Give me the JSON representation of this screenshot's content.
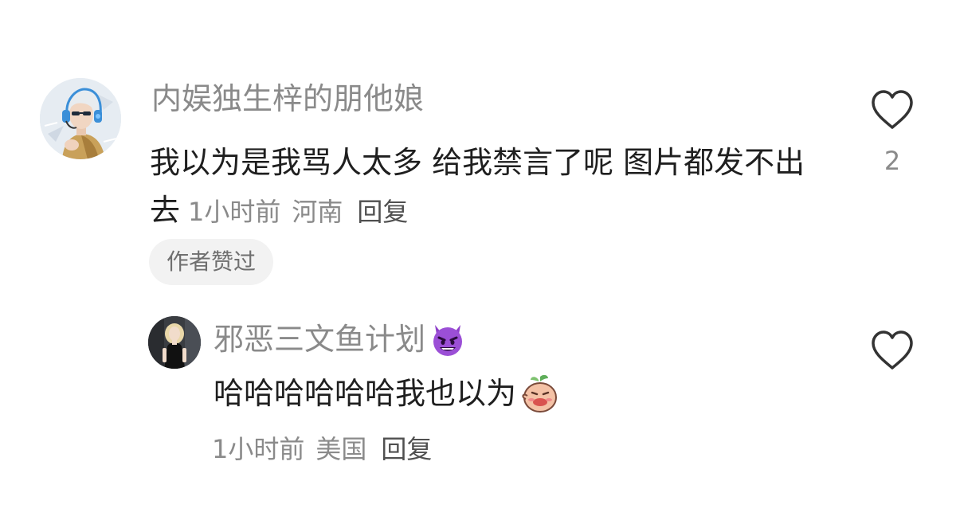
{
  "comment": {
    "username": "内娱独生梓的朋他娘",
    "text": "我以为是我骂人太多 给我禁言了呢 图片都发不出去",
    "time": "1小时前",
    "location": "河南",
    "reply_label": "回复",
    "author_liked_label": "作者赞过",
    "like_count": "2",
    "avatar_icon": "avatar-illustrated-boy-headphones"
  },
  "reply": {
    "username": "邪恶三文鱼计划",
    "username_emoji": "smiling-devil-emoji",
    "text": "哈哈哈哈哈哈我也以为",
    "text_emoji": "peach-sticker-emoji",
    "time": "1小时前",
    "location": "美国",
    "reply_label": "回复",
    "avatar_icon": "avatar-woman-black-dress"
  },
  "colors": {
    "text_primary": "#1f1f1f",
    "text_secondary": "#8a8a8a",
    "chip_background": "#f2f2f2",
    "devil_purple": "#8e3fc9"
  }
}
